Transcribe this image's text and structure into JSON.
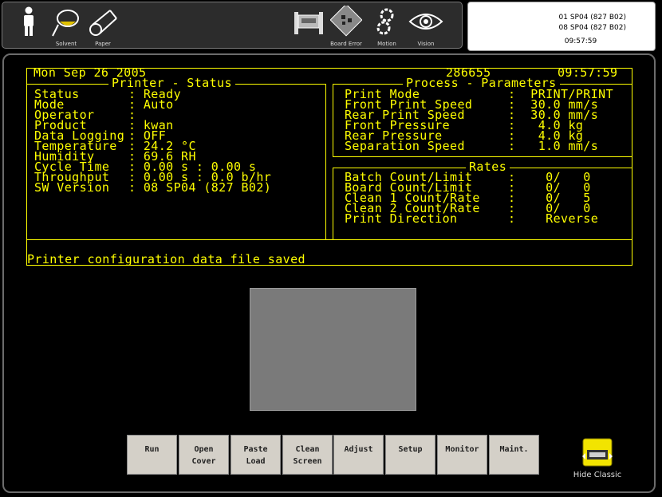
{
  "toolbar": {
    "items": [
      {
        "icon": "operator-icon",
        "label": ""
      },
      {
        "icon": "solvent-icon",
        "label": "Solvent"
      },
      {
        "icon": "paper-icon",
        "label": "Paper"
      },
      {
        "icon": "printer-machine-icon",
        "label": ""
      },
      {
        "icon": "board-error-icon",
        "label": "Board Error"
      },
      {
        "icon": "motion-icon",
        "label": "Motion"
      },
      {
        "icon": "vision-icon",
        "label": "Vision"
      }
    ]
  },
  "info": {
    "line1": "01 SP04 (827 B02)",
    "line2": "08 SP04 (827 B02)",
    "time": "09:57:59"
  },
  "header": {
    "date": "Mon Sep 26 2005",
    "count": "286655",
    "time": "09:57:59"
  },
  "printer_status": {
    "title": "Printer - Status",
    "rows": [
      {
        "label": "Status",
        "value": "Ready"
      },
      {
        "label": "Mode",
        "value": "Auto"
      },
      {
        "label": "Operator",
        "value": ""
      },
      {
        "label": "Product",
        "value": "kwan"
      },
      {
        "label": "Data Logging",
        "value": "OFF"
      },
      {
        "label": "Temperature",
        "value": "24.2 °C"
      },
      {
        "label": "Humidity",
        "value": "69.6 RH"
      },
      {
        "label": "Cycle Time",
        "value": "0.00 s : 0.00 s"
      },
      {
        "label": "Throughput",
        "value": "0.00 s : 0.0 b/hr"
      },
      {
        "label": "SW Version",
        "value": "08 SP04 (827 B02)"
      }
    ]
  },
  "process_parameters": {
    "title": "Process - Parameters",
    "rows": [
      {
        "label": "Print Mode",
        "value": "PRINT/PRINT"
      },
      {
        "label": "Front Print Speed",
        "value": "30.0 mm/s"
      },
      {
        "label": "Rear Print Speed",
        "value": "30.0 mm/s"
      },
      {
        "label": "Front Pressure",
        "value": " 4.0 kg"
      },
      {
        "label": "Rear Pressure",
        "value": " 4.0 kg"
      },
      {
        "label": "Separation Speed",
        "value": " 1.0 mm/s"
      }
    ]
  },
  "rates": {
    "title": "Rates",
    "rows": [
      {
        "label": "Batch Count/Limit",
        "value": "  0/   0"
      },
      {
        "label": "Board Count/Limit",
        "value": "  0/   0"
      },
      {
        "label": "Clean 1 Count/Rate",
        "value": "  0/   5"
      },
      {
        "label": "Clean 2 Count/Rate",
        "value": "  0/   0"
      },
      {
        "label": "Print Direction",
        "value": "  Reverse"
      }
    ]
  },
  "message": "Printer configuration data file saved",
  "buttons": [
    {
      "l1": "Run",
      "l2": ""
    },
    {
      "l1": "Open",
      "l2": "Cover"
    },
    {
      "l1": "Paste",
      "l2": "Load"
    },
    {
      "l1": "Clean",
      "l2": "Screen"
    },
    {
      "l1": "Adjust",
      "l2": ""
    },
    {
      "l1": "Setup",
      "l2": ""
    },
    {
      "l1": "Monitor",
      "l2": ""
    },
    {
      "l1": "Maint.",
      "l2": ""
    }
  ],
  "hide_classic": {
    "label": "Hide Classic",
    "icon": "hide-classic-icon"
  },
  "colors": {
    "accent": "#ffff00",
    "background": "#000000"
  }
}
